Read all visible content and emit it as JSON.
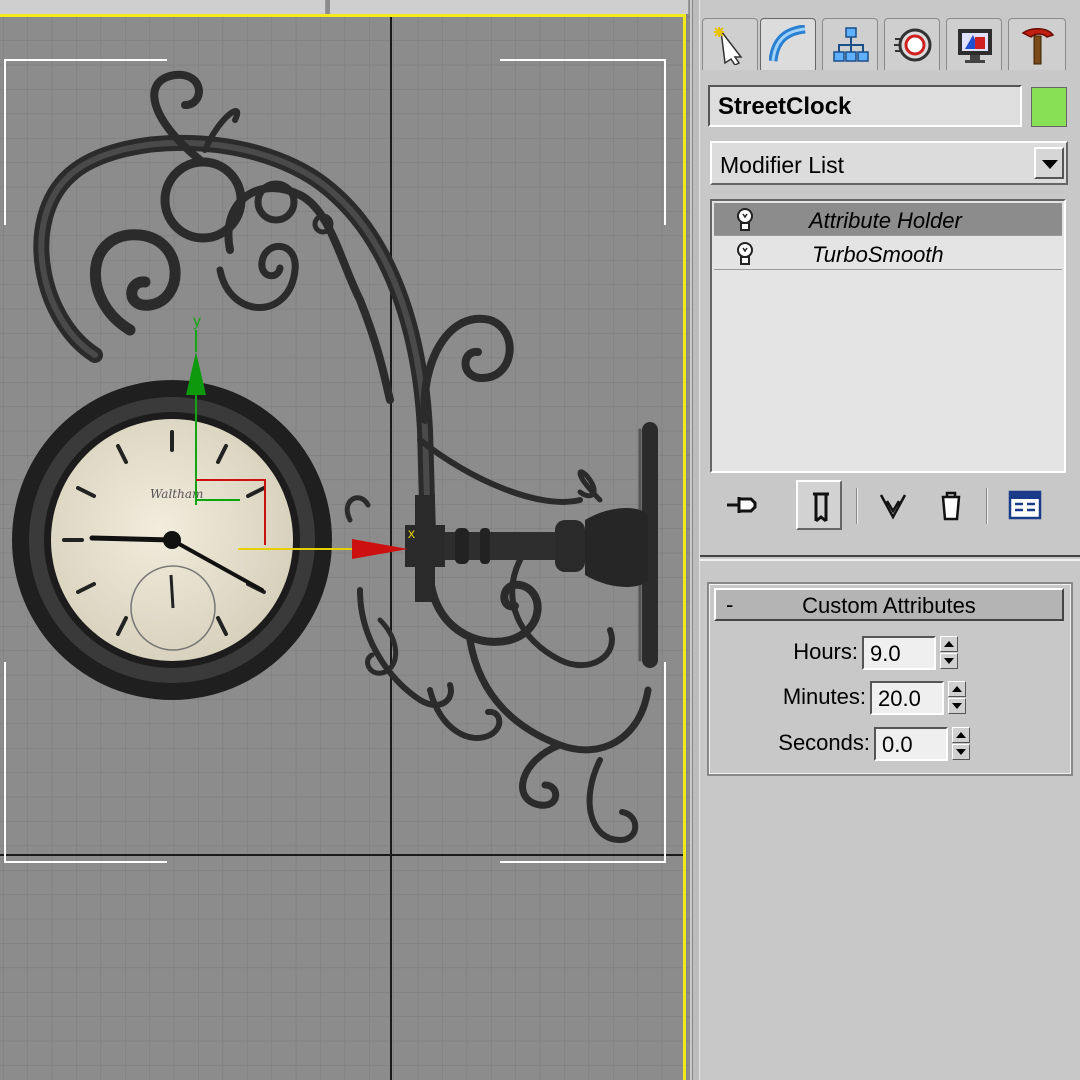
{
  "object": {
    "name": "StreetClock",
    "color": "#88e055"
  },
  "command_panel": {
    "tabs": [
      "create-icon",
      "modify-icon",
      "hierarchy-icon",
      "motion-icon",
      "display-icon",
      "utilities-icon"
    ],
    "active_tab": "modify-icon"
  },
  "modifier_list": {
    "label": "Modifier List"
  },
  "modifier_stack": {
    "items": [
      {
        "label": "Attribute Holder",
        "selected": true
      },
      {
        "label": "TurboSmooth",
        "selected": false
      }
    ]
  },
  "stack_tools": [
    "pin-stack-icon",
    "show-end-result-icon",
    "make-unique-icon",
    "remove-modifier-icon",
    "configure-modifier-sets-icon"
  ],
  "rollout": {
    "collapse_symbol": "-",
    "title": "Custom Attributes",
    "params": [
      {
        "label": "Hours:",
        "value": "9.0"
      },
      {
        "label": "Minutes:",
        "value": "20.0"
      },
      {
        "label": "Seconds:",
        "value": "0.0"
      }
    ]
  },
  "viewport": {
    "border_color": "#f4ea1a",
    "background": "#8c8c8c",
    "gizmo_label": "y"
  }
}
